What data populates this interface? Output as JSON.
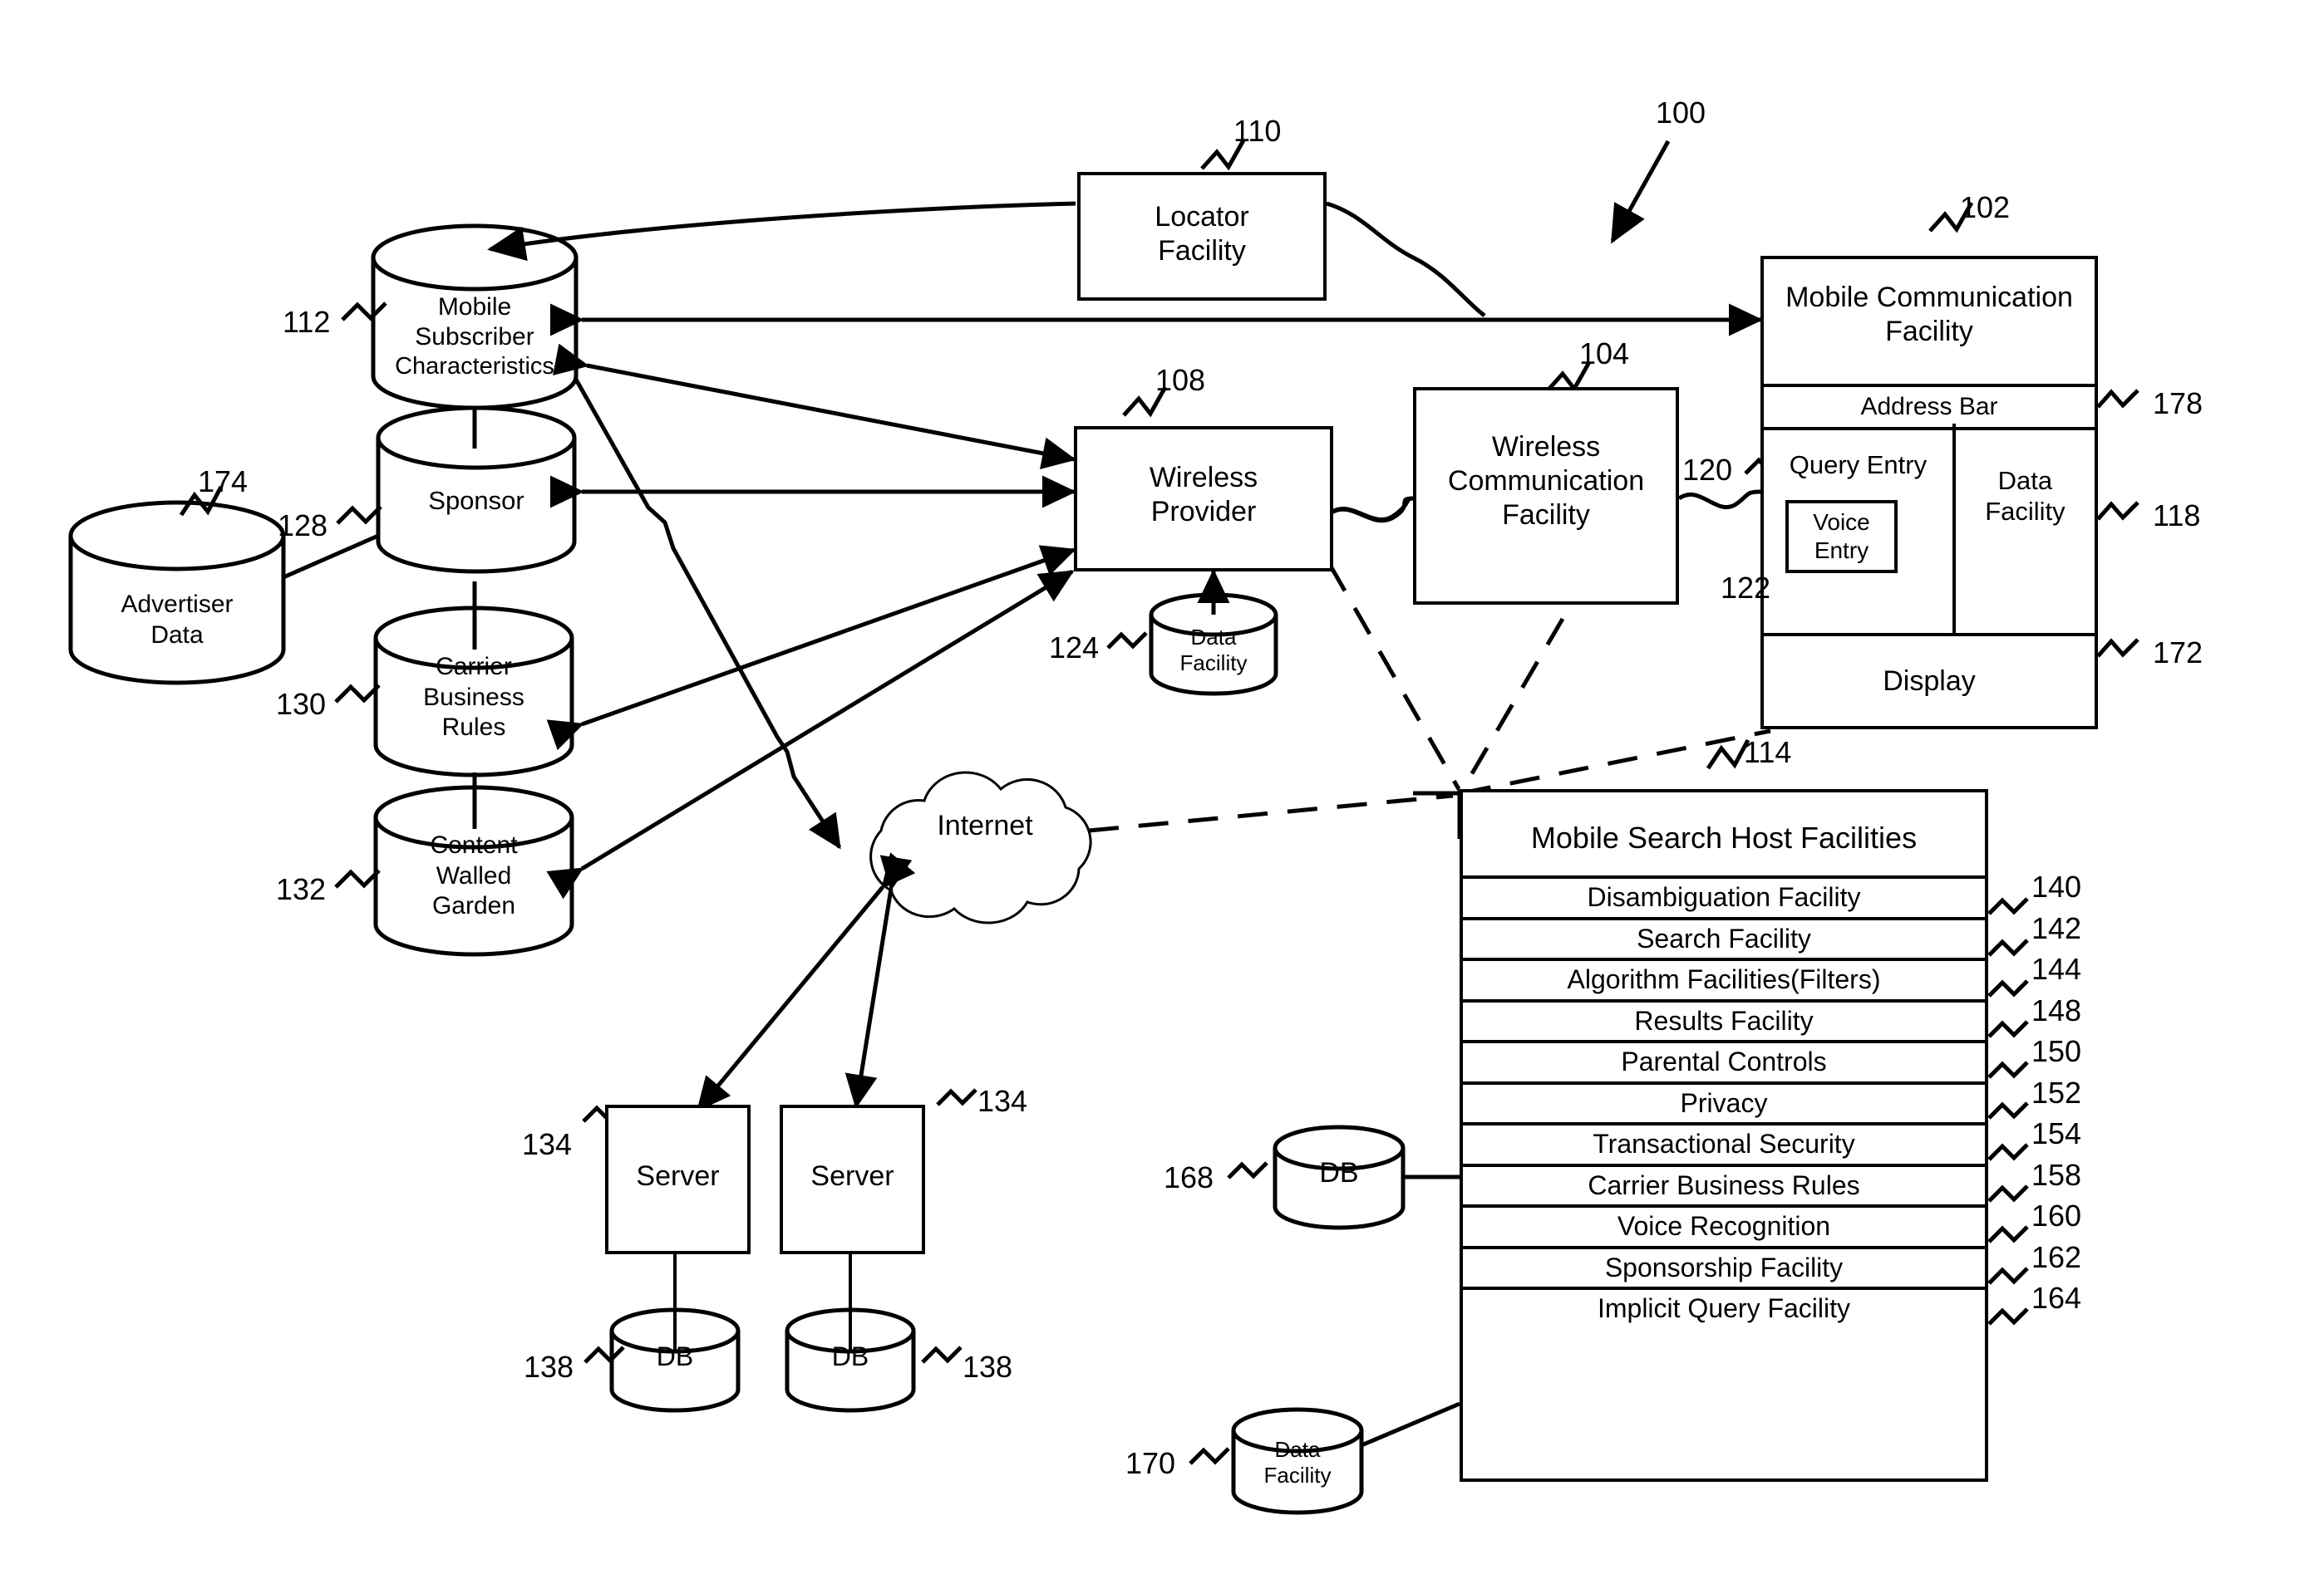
{
  "figure": {
    "type": "patent-system-diagram",
    "system_ref": "100"
  },
  "nodes": {
    "locator_facility": {
      "label": "Locator\nFacility",
      "line1": "Locator",
      "line2": "Facility",
      "ref": "110"
    },
    "wireless_provider": {
      "line1": "Wireless",
      "line2": "Provider",
      "ref": "108"
    },
    "wireless_comm_facility": {
      "line1": "Wireless",
      "line2": "Communication",
      "line3": "Facility",
      "ref": "104"
    },
    "mobile_comm_facility": {
      "line1": "Mobile Communication",
      "line2": "Facility",
      "ref": "102"
    },
    "internet": {
      "label": "Internet"
    },
    "server_left": {
      "label": "Server",
      "ref": "134"
    },
    "server_right": {
      "label": "Server",
      "ref": "134"
    },
    "system_arrow": {
      "ref": "100"
    }
  },
  "cylinders": {
    "mobile_subscriber_characteristics": {
      "line1": "Mobile",
      "line2": "Subscriber",
      "line3": "Characteristics",
      "ref": "112"
    },
    "sponsor": {
      "line1": "Sponsor",
      "ref": "128"
    },
    "carrier_business_rules": {
      "line1": "Carrier",
      "line2": "Business",
      "line3": "Rules",
      "ref": "130"
    },
    "content_walled_garden": {
      "line1": "Content",
      "line2": "Walled",
      "line3": "Garden",
      "ref": "132"
    },
    "advertiser_data": {
      "line1": "Advertiser",
      "line2": "Data",
      "ref": "174"
    },
    "wp_data_facility": {
      "line1": "Data",
      "line2": "Facility",
      "ref": "124"
    },
    "db_left": {
      "label": "DB",
      "ref": "138"
    },
    "db_right": {
      "label": "DB",
      "ref": "138"
    },
    "host_db": {
      "label": "DB",
      "ref": "168"
    },
    "host_data_facility": {
      "line1": "Data",
      "line2": "Facility",
      "ref": "170"
    }
  },
  "device": {
    "title_line1": "Mobile Communication",
    "title_line2": "Facility",
    "title_ref": "102",
    "address_bar": {
      "label": "Address Bar",
      "ref": "178"
    },
    "query_entry": {
      "label": "Query Entry",
      "ref": "120"
    },
    "voice_entry": {
      "line1": "Voice",
      "line2": "Entry",
      "ref": "122"
    },
    "data_facility": {
      "line1": "Data",
      "line2": "Facility",
      "ref": "118"
    },
    "display": {
      "label": "Display",
      "ref": "172"
    }
  },
  "host": {
    "title": "Mobile Search Host Facilities",
    "ref": "114",
    "facilities": [
      {
        "label": "Disambiguation Facility",
        "ref": "140"
      },
      {
        "label": "Search Facility",
        "ref": "142"
      },
      {
        "label": "Algorithm Facilities(Filters)",
        "ref": "144"
      },
      {
        "label": "Results Facility",
        "ref": "148"
      },
      {
        "label": "Parental Controls",
        "ref": "150"
      },
      {
        "label": "Privacy",
        "ref": "152"
      },
      {
        "label": "Transactional Security",
        "ref": "154"
      },
      {
        "label": "Carrier Business Rules",
        "ref": "158"
      },
      {
        "label": "Voice Recognition",
        "ref": "160"
      },
      {
        "label": "Sponsorship Facility",
        "ref": "162"
      },
      {
        "label": "Implicit Query Facility",
        "ref": "164"
      }
    ]
  },
  "colors": {
    "stroke": "#000000",
    "background": "#ffffff"
  }
}
